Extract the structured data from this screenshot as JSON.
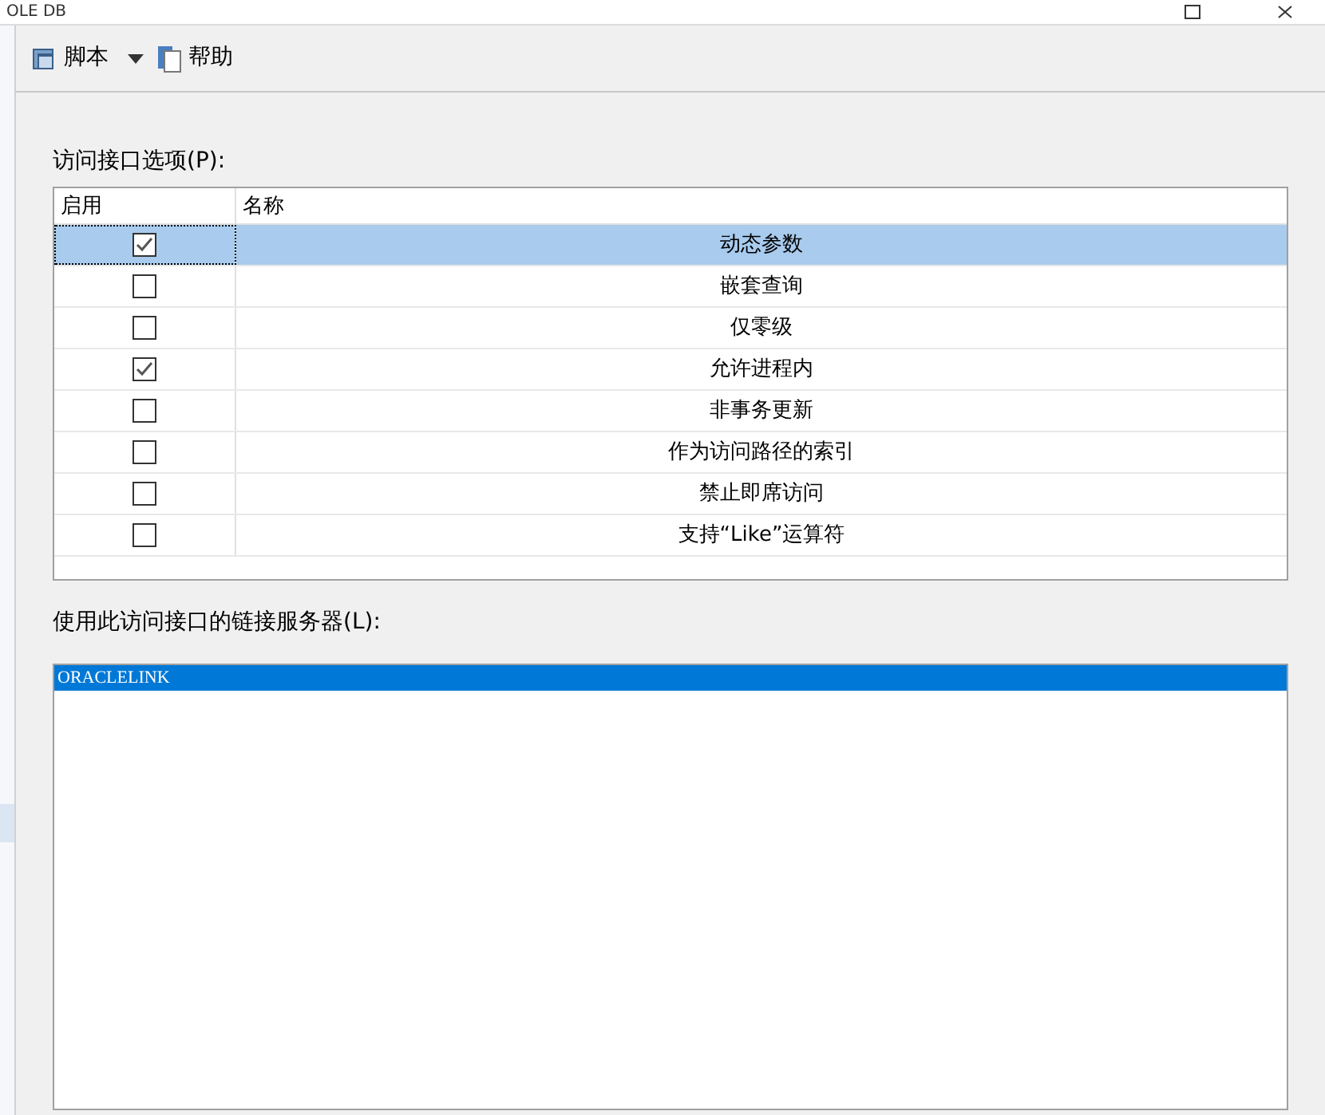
{
  "window": {
    "title": "OLE DB"
  },
  "toolbar": {
    "script": "脚本",
    "help": "帮助"
  },
  "options_label": "访问接口选项(P):",
  "table": {
    "columns": [
      "启用",
      "名称"
    ],
    "rows": [
      {
        "enabled": true,
        "name": "动态参数",
        "selected": true
      },
      {
        "enabled": false,
        "name": "嵌套查询",
        "selected": false
      },
      {
        "enabled": false,
        "name": "仅零级",
        "selected": false
      },
      {
        "enabled": true,
        "name": "允许进程内",
        "selected": false
      },
      {
        "enabled": false,
        "name": "非事务更新",
        "selected": false
      },
      {
        "enabled": false,
        "name": "作为访问路径的索引",
        "selected": false
      },
      {
        "enabled": false,
        "name": "禁止即席访问",
        "selected": false
      },
      {
        "enabled": false,
        "name": "支持“Like”运算符",
        "selected": false
      }
    ]
  },
  "servers_label": "使用此访问接口的链接服务器(L):",
  "servers": [
    {
      "name": "ORACLELINK",
      "selected": true
    }
  ]
}
